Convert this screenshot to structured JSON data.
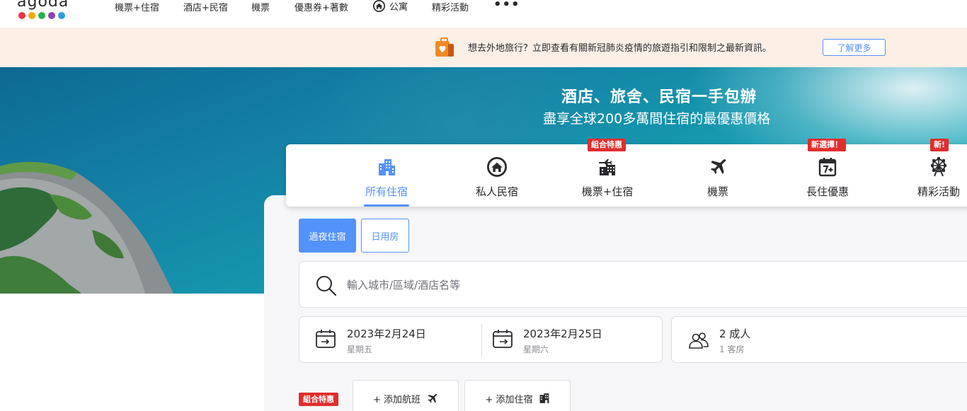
{
  "brand": {
    "logo_text": "agoda",
    "dot_colors": [
      "#ef3340",
      "#f7a600",
      "#26b14a",
      "#8e44ad",
      "#2a9fd8"
    ]
  },
  "nav": {
    "items": [
      "機票+住宿",
      "酒店+民宿",
      "機票",
      "優惠券+著數",
      "公寓",
      "精彩活動"
    ],
    "more": "•••"
  },
  "banner": {
    "text": "想去外地旅行？立即查看有關新冠肺炎疫情的旅遊指引和限制之最新資訊。",
    "button": "了解更多"
  },
  "hero": {
    "title": "酒店、旅舍、民宿一手包辦",
    "subtitle": "盡享全球200多萬間住宿的最優惠價格"
  },
  "tabs": [
    {
      "label": "所有住宿",
      "icon": "building-icon",
      "badge": "",
      "active": true
    },
    {
      "label": "私人民宿",
      "icon": "home-icon",
      "badge": ""
    },
    {
      "label": "機票+住宿",
      "icon": "flight-hotel-icon",
      "badge": "組合特惠"
    },
    {
      "label": "機票",
      "icon": "plane-icon",
      "badge": ""
    },
    {
      "label": "長住優惠",
      "icon": "calendar-7-icon",
      "badge": "新選擇！"
    },
    {
      "label": "精彩活動",
      "icon": "ferris-wheel-icon",
      "badge": "新!"
    }
  ],
  "stay_type": {
    "overnight": "過夜住宿",
    "day_use": "日用房"
  },
  "search": {
    "placeholder": "輸入城市/區域/酒店名等"
  },
  "dates": {
    "checkin_date": "2023年2月24日",
    "checkin_day": "星期五",
    "checkout_date": "2023年2月25日",
    "checkout_day": "星期六"
  },
  "guests": {
    "adults": "2 成人",
    "rooms": "1 客房"
  },
  "bundle": {
    "badge": "組合特惠",
    "add_flight": "+ 添加航班",
    "add_hotel": "+ 添加住宿"
  },
  "colors": {
    "accent": "#5392f9",
    "badge_red": "#e12d2d",
    "banner_bg": "#fcefe6"
  }
}
